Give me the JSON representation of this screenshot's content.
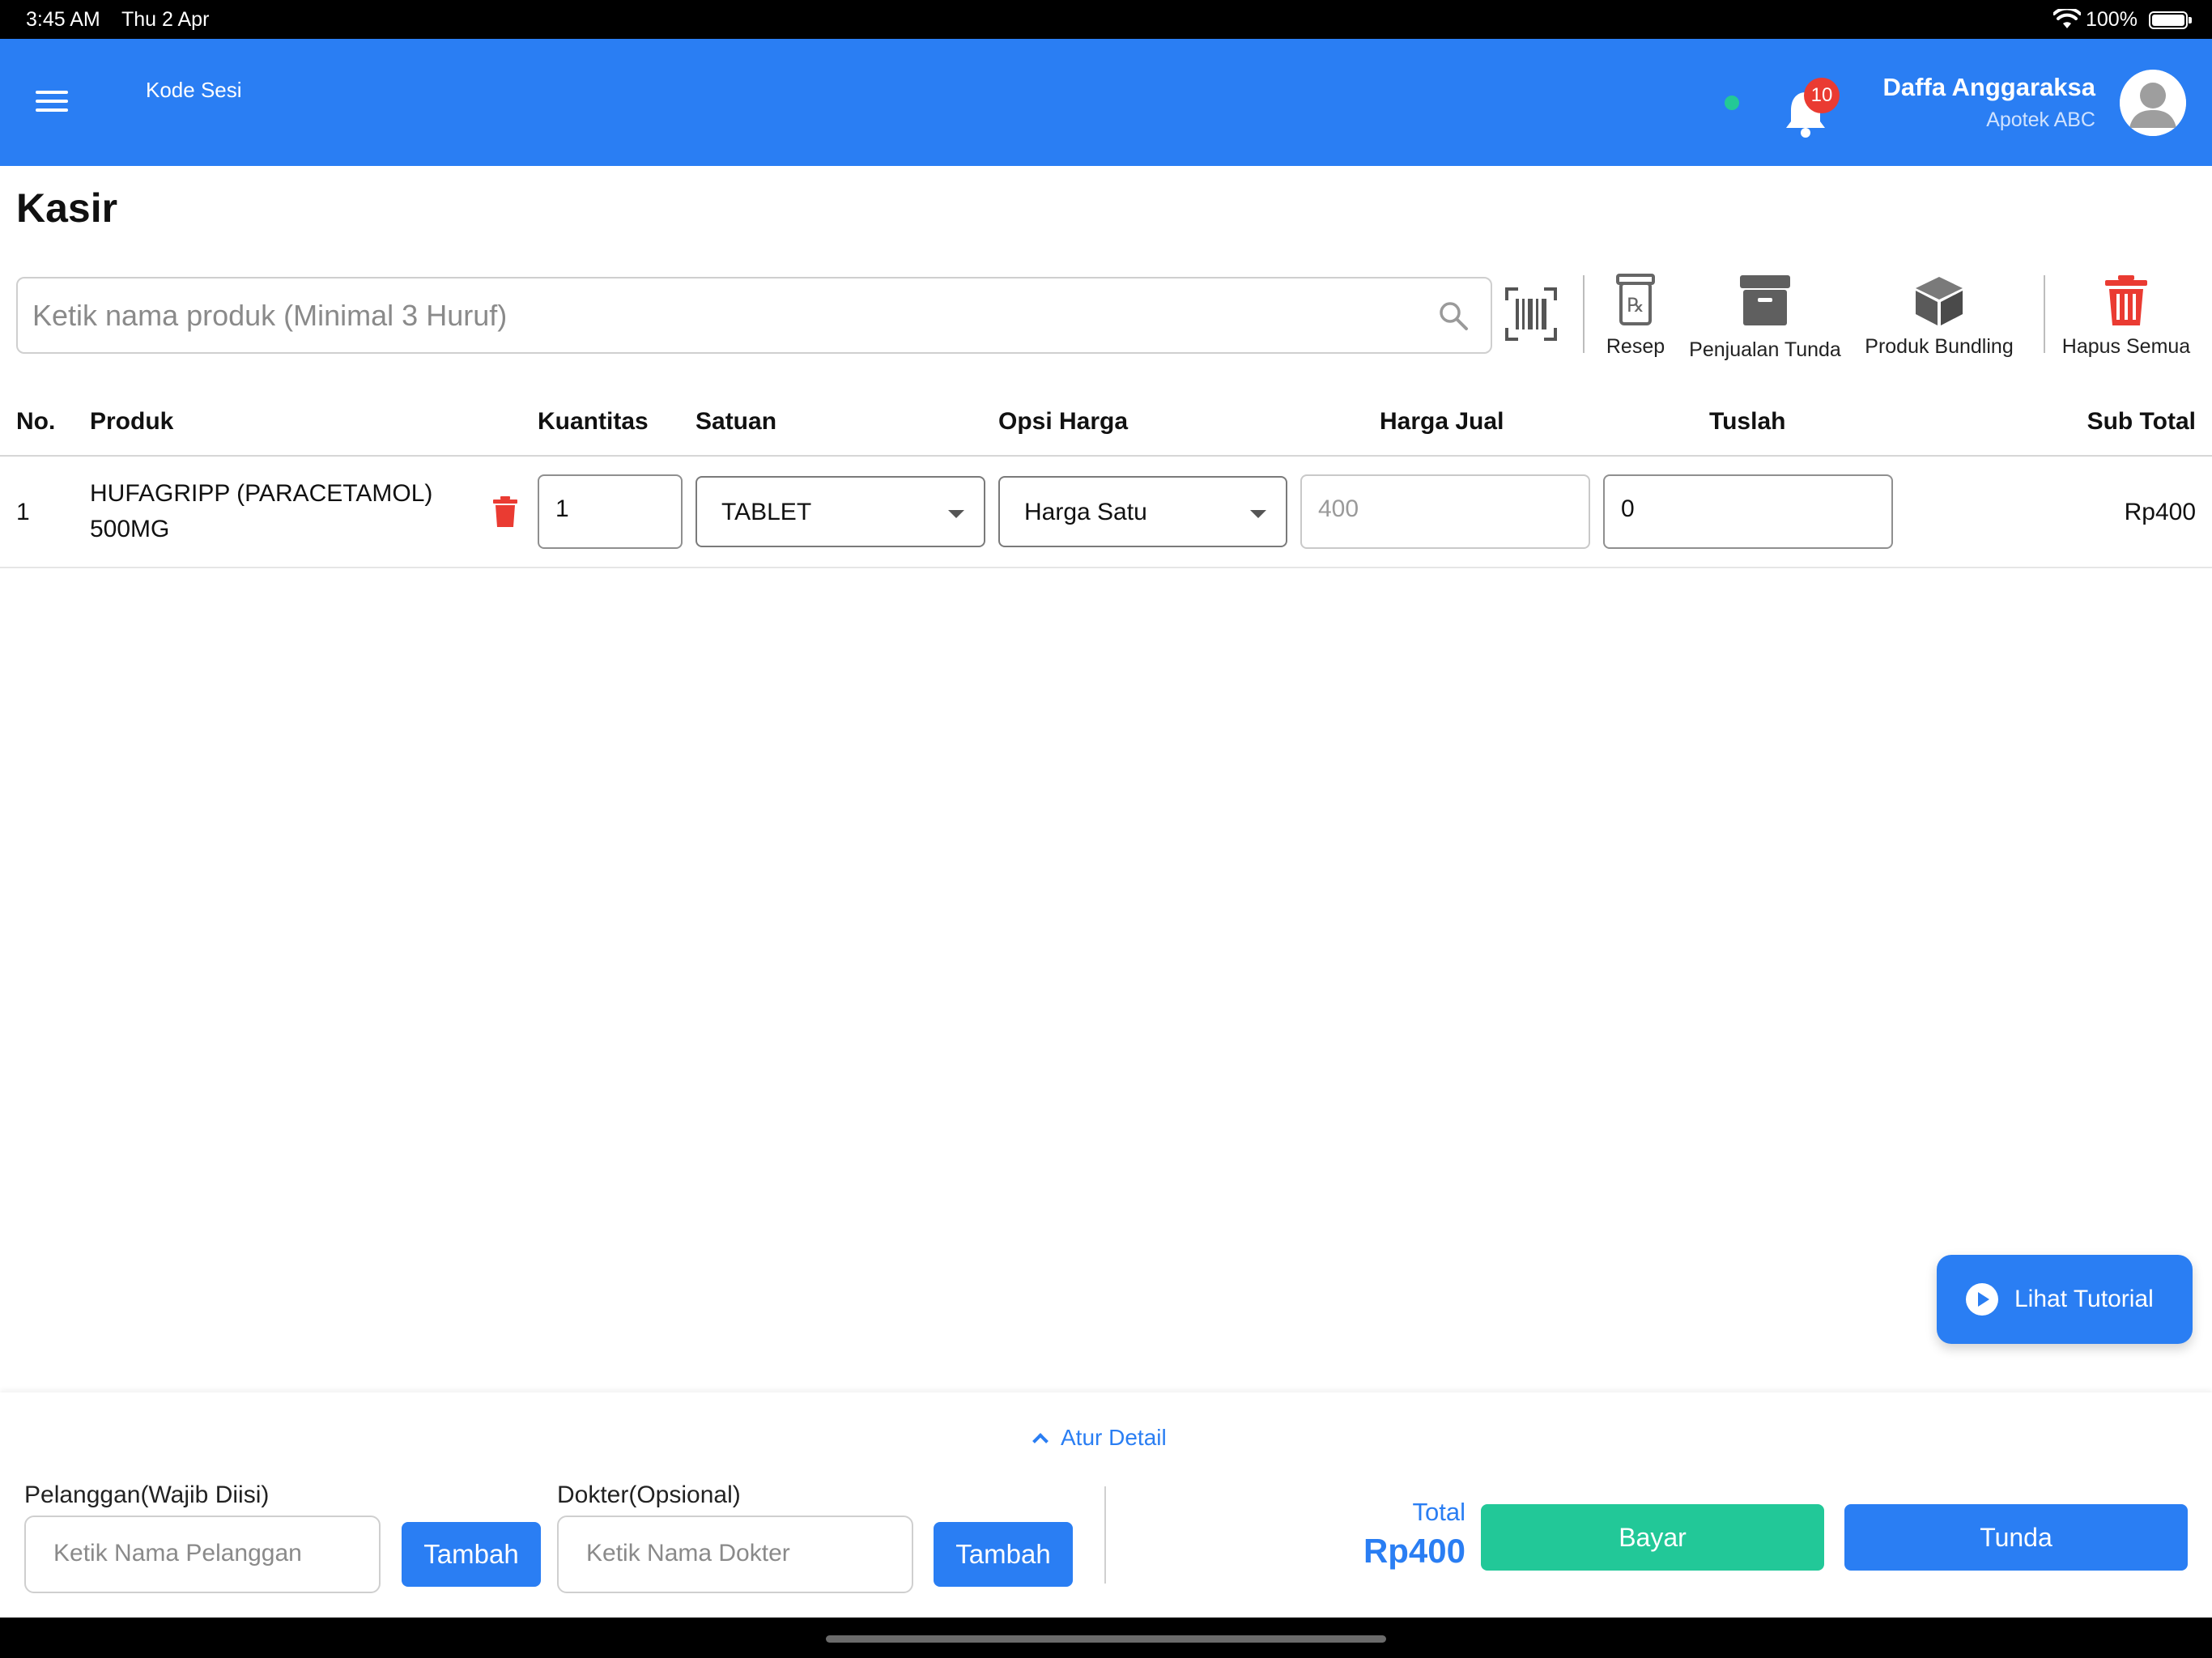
{
  "status_bar": {
    "time": "3:45 AM",
    "date": "Thu 2 Apr",
    "battery": "100%"
  },
  "app_bar": {
    "session_label": "Kode Sesi",
    "notification_count": "10",
    "user_name": "Daffa Anggaraksa",
    "store_name": "Apotek ABC",
    "colors": {
      "primary": "#2a7ef3",
      "online": "#23c996",
      "badge": "#ea3b32"
    }
  },
  "page": {
    "title": "Kasir"
  },
  "search": {
    "placeholder": "Ketik nama produk (Minimal 3 Huruf)",
    "value": ""
  },
  "toolbar": {
    "resep": "Resep",
    "penjualan_tunda": "Penjualan Tunda",
    "produk_bundling": "Produk Bundling",
    "hapus_semua": "Hapus Semua"
  },
  "table": {
    "headers": {
      "no": "No.",
      "produk": "Produk",
      "kuantitas": "Kuantitas",
      "satuan": "Satuan",
      "opsi_harga": "Opsi Harga",
      "harga_jual": "Harga Jual",
      "tuslah": "Tuslah",
      "sub_total": "Sub Total"
    },
    "rows": [
      {
        "no": "1",
        "produk_line1": "HUFAGRIPP (PARACETAMOL)",
        "produk_line2": "500MG",
        "kuantitas": "1",
        "satuan": "TABLET",
        "opsi_harga": "Harga Satu",
        "harga_jual": "400",
        "tuslah": "0",
        "sub_total": "Rp400"
      }
    ]
  },
  "tutorial_button": "Lihat Tutorial",
  "bottom": {
    "atur_detail": "Atur Detail",
    "pelanggan_label": "Pelanggan(Wajib Diisi)",
    "pelanggan_placeholder": "Ketik Nama Pelanggan",
    "dokter_label": "Dokter(Opsional)",
    "dokter_placeholder": "Ketik Nama Dokter",
    "tambah": "Tambah",
    "total_label": "Total",
    "total_value": "Rp400",
    "bayar": "Bayar",
    "tunda": "Tunda",
    "colors": {
      "bayar": "#22c898",
      "tunda": "#2a7ef3"
    }
  }
}
